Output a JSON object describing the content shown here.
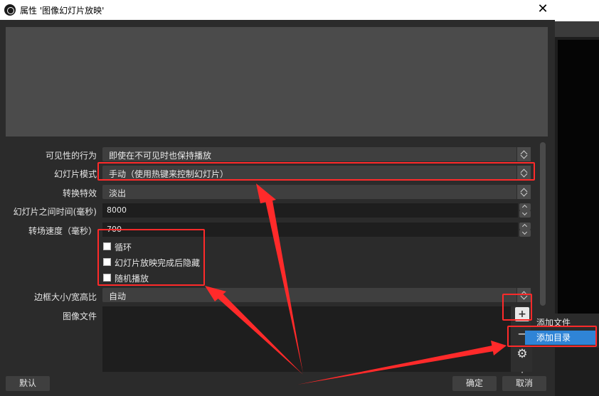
{
  "window": {
    "title": "属性 '图像幻灯片放映'",
    "close_glyph": "✕"
  },
  "form": {
    "visibility": {
      "label": "可见性的行为",
      "value": "即使在不可见时也保持播放"
    },
    "slide_mode": {
      "label": "幻灯片模式",
      "value": "手动（使用热键来控制幻灯片）"
    },
    "transition": {
      "label": "转换特效",
      "value": "淡出"
    },
    "slide_time": {
      "label": "幻灯片之间时间(毫秒)",
      "value": "8000"
    },
    "transition_speed": {
      "label": "转场速度（毫秒）",
      "value": "700"
    },
    "loop": {
      "label": "循环",
      "checked": false
    },
    "hide_when_done": {
      "label": "幻灯片放映完成后隐藏",
      "checked": false
    },
    "random": {
      "label": "随机播放",
      "checked": false
    },
    "bounding_size": {
      "label": "边框大小/宽高比",
      "value": "自动"
    },
    "image_files": {
      "label": "图像文件"
    }
  },
  "file_buttons": {
    "add": "+",
    "remove": "−",
    "settings": "⚙",
    "more": "·"
  },
  "add_menu": {
    "items": [
      "添加文件",
      "添加目录"
    ],
    "selected": "添加目录"
  },
  "buttons": {
    "defaults": "默认",
    "ok": "确定",
    "cancel": "取消"
  },
  "colors": {
    "annotation": "#ff2a2a",
    "menu_highlight": "#2f84d6",
    "background": "#2b2b2b"
  }
}
